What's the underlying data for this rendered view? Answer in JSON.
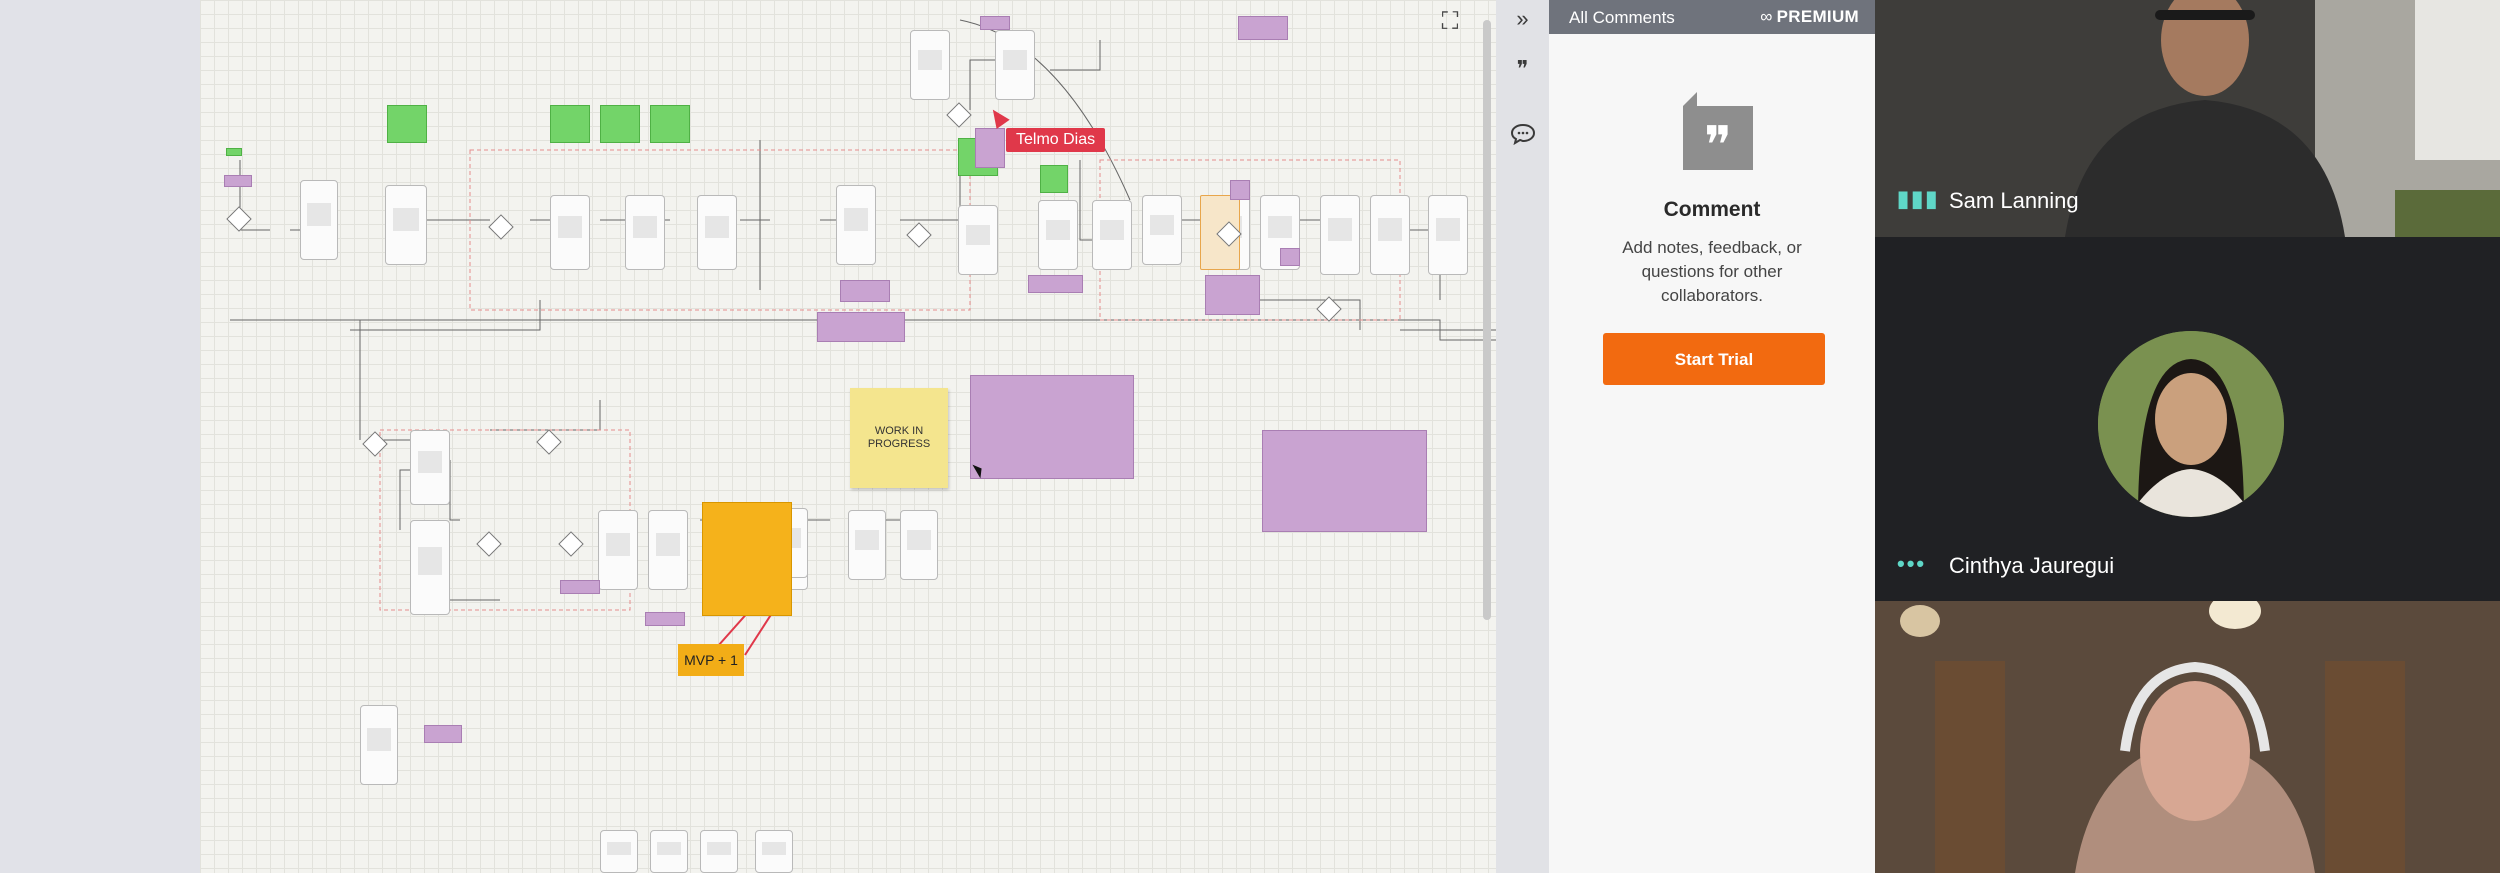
{
  "canvas": {
    "label_telmo": "Telmo Dias",
    "label_wip": "WORK IN PROGRESS",
    "label_mvp": "MVP + 1",
    "expand_icon": "expand-icon"
  },
  "icon_strip": {
    "items": [
      "chevrons-right-icon",
      "quote-icon",
      "comment-icon"
    ]
  },
  "comments_panel": {
    "tab": "All Comments",
    "premium": "PREMIUM",
    "premium_icon": "∞",
    "title": "Comment",
    "description": "Add notes, feedback, or questions for other collaborators.",
    "cta": "Start Trial"
  },
  "participants": [
    {
      "name": "Sam Lanning",
      "status": "speaking"
    },
    {
      "name": "Cinthya Jauregui",
      "status": "idle"
    },
    {
      "name": "",
      "status": "camera"
    }
  ],
  "colors": {
    "accent_orange": "#f26a10",
    "header_gray": "#6f737c",
    "speaking_teal": "#5fd7c7",
    "cursor_red": "#e0384a"
  }
}
